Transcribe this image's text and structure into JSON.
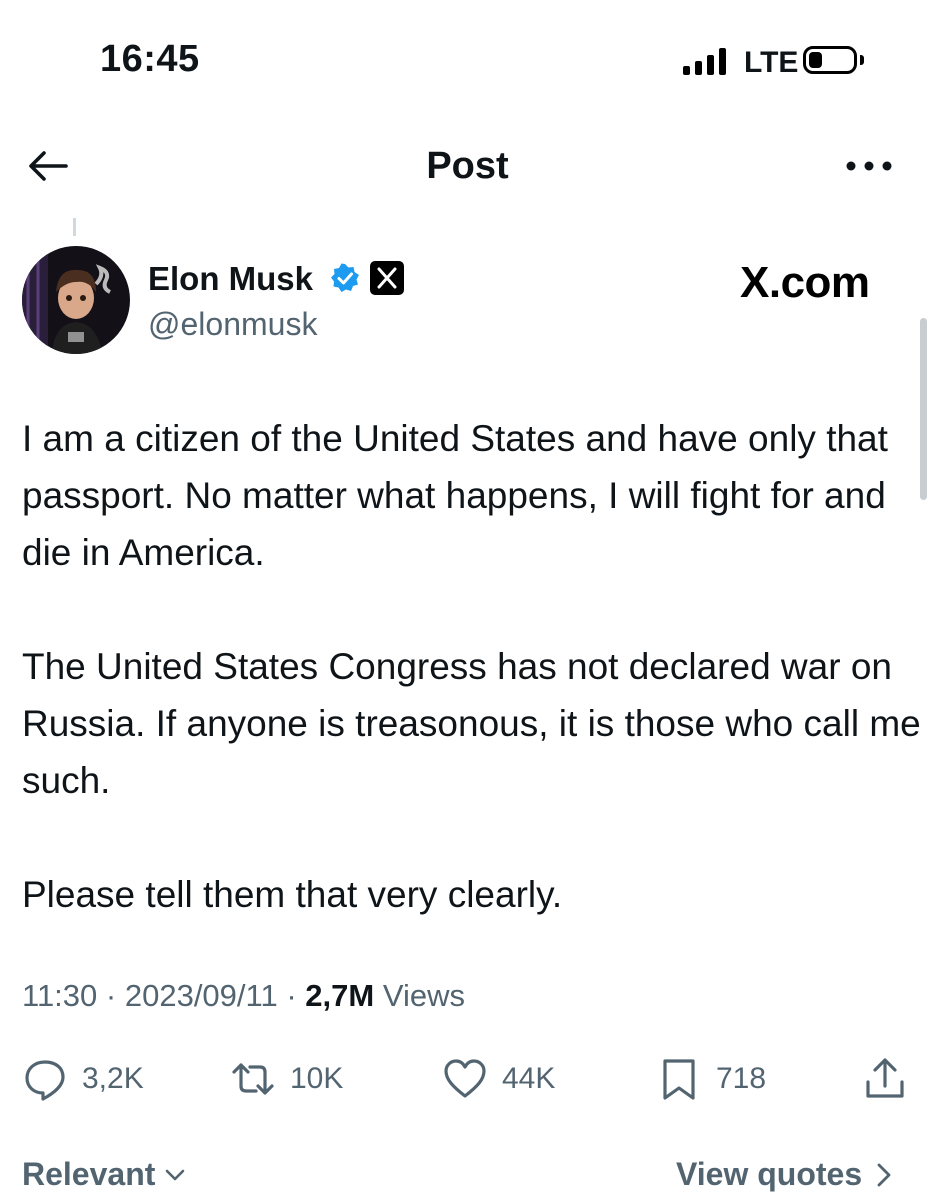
{
  "status_bar": {
    "time": "16:45",
    "network": "LTE",
    "battery_level": 0.3,
    "signal_bars": 4
  },
  "header": {
    "title": "Post",
    "back_icon": "arrow-left-icon",
    "more_icon": "more-horizontal-icon"
  },
  "author": {
    "name": "Elon Musk",
    "handle": "@elonmusk",
    "verified": true,
    "affiliate_badge": "X",
    "verified_color": "#1d9bf0"
  },
  "watermark": "X.com",
  "tweet": {
    "paragraphs": [
      "I am a citizen of the United States and have only that passport. No matter what happens, I will fight for and die in America.",
      "The United States Congress has not declared war on Russia. If anyone is treasonous, it is those who call me such.",
      "Please tell them that very clearly."
    ],
    "time": "11:30",
    "date": "2023/09/11",
    "separator": "·",
    "views_count": "2,7M",
    "views_label": "Views"
  },
  "actions": {
    "replies": "3,2K",
    "reposts": "10K",
    "likes": "44K",
    "bookmarks": "718"
  },
  "footer": {
    "sort_label": "Relevant",
    "quotes_label": "View quotes"
  },
  "colors": {
    "text": "#0f1419",
    "secondary": "#536471",
    "accent": "#1d9bf0"
  }
}
